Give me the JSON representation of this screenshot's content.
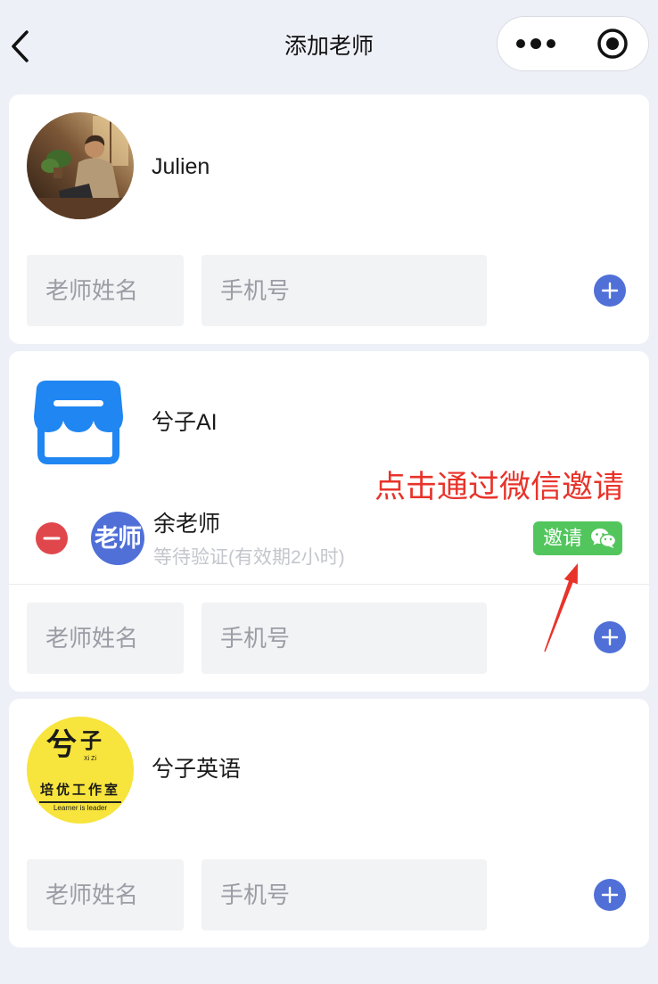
{
  "nav": {
    "back_icon": "chevron-left-icon",
    "title": "添加老师",
    "more_icon": "more-dots-icon",
    "close_icon": "record-icon"
  },
  "theme": {
    "background": "#eef0f8",
    "card": "#ffffff",
    "input_background": "#f2f3f5",
    "accent_blue": "#5070d8",
    "remove_red": "#e0474d",
    "wechat_green": "#52c65d",
    "annotation_red": "#e8332a",
    "store_blue": "#1f86f2",
    "logo_yellow": "#f7e43c"
  },
  "teams": [
    {
      "name": "Julien",
      "logo_icon": "user-photo-avatar",
      "form": {
        "name_placeholder": "老师姓名",
        "phone_placeholder": "手机号",
        "add_icon": "plus-circle-icon"
      }
    },
    {
      "name": "兮子AI",
      "logo_icon": "storefront-icon",
      "members": [
        {
          "avatar_text": "老师",
          "name": "余老师",
          "status": "等待验证(有效期2小时)",
          "invite_label": "邀请",
          "invite_icon": "wechat-icon",
          "remove_icon": "minus-circle-icon"
        }
      ],
      "form": {
        "name_placeholder": "老师姓名",
        "phone_placeholder": "手机号",
        "add_icon": "plus-circle-icon"
      }
    },
    {
      "name": "兮子英语",
      "logo_icon": "xizi-logo",
      "logo_text": {
        "char_1": "兮",
        "char_2": "子",
        "pinyin": "Xi Zi",
        "tagline": "培优工作室",
        "motto": "Learner is leader"
      },
      "form": {
        "name_placeholder": "老师姓名",
        "phone_placeholder": "手机号",
        "add_icon": "plus-circle-icon"
      }
    }
  ],
  "annotation": {
    "text": "点击通过微信邀请",
    "arrow_icon": "red-arrow-icon"
  }
}
